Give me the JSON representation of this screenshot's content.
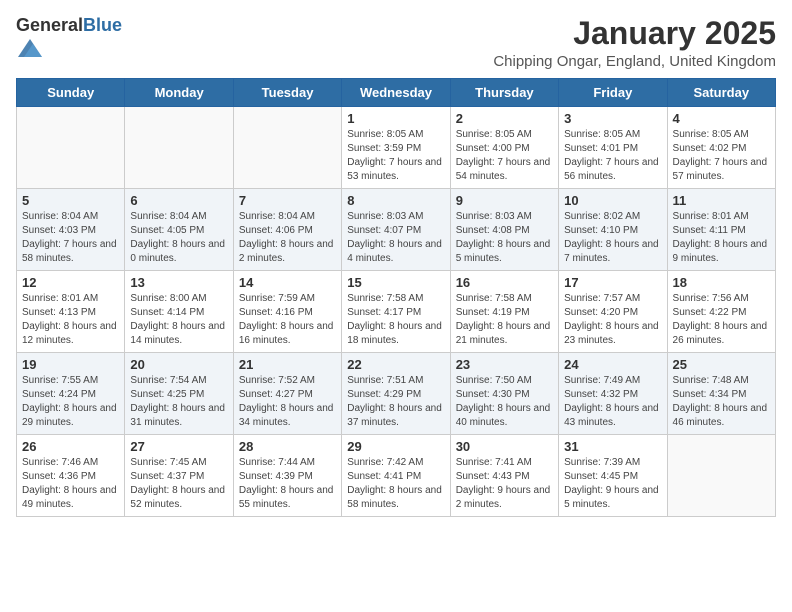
{
  "header": {
    "logo_general": "General",
    "logo_blue": "Blue",
    "month_title": "January 2025",
    "location": "Chipping Ongar, England, United Kingdom"
  },
  "weekdays": [
    "Sunday",
    "Monday",
    "Tuesday",
    "Wednesday",
    "Thursday",
    "Friday",
    "Saturday"
  ],
  "weeks": [
    [
      {
        "day": "",
        "info": ""
      },
      {
        "day": "",
        "info": ""
      },
      {
        "day": "",
        "info": ""
      },
      {
        "day": "1",
        "info": "Sunrise: 8:05 AM\nSunset: 3:59 PM\nDaylight: 7 hours and 53 minutes."
      },
      {
        "day": "2",
        "info": "Sunrise: 8:05 AM\nSunset: 4:00 PM\nDaylight: 7 hours and 54 minutes."
      },
      {
        "day": "3",
        "info": "Sunrise: 8:05 AM\nSunset: 4:01 PM\nDaylight: 7 hours and 56 minutes."
      },
      {
        "day": "4",
        "info": "Sunrise: 8:05 AM\nSunset: 4:02 PM\nDaylight: 7 hours and 57 minutes."
      }
    ],
    [
      {
        "day": "5",
        "info": "Sunrise: 8:04 AM\nSunset: 4:03 PM\nDaylight: 7 hours and 58 minutes."
      },
      {
        "day": "6",
        "info": "Sunrise: 8:04 AM\nSunset: 4:05 PM\nDaylight: 8 hours and 0 minutes."
      },
      {
        "day": "7",
        "info": "Sunrise: 8:04 AM\nSunset: 4:06 PM\nDaylight: 8 hours and 2 minutes."
      },
      {
        "day": "8",
        "info": "Sunrise: 8:03 AM\nSunset: 4:07 PM\nDaylight: 8 hours and 4 minutes."
      },
      {
        "day": "9",
        "info": "Sunrise: 8:03 AM\nSunset: 4:08 PM\nDaylight: 8 hours and 5 minutes."
      },
      {
        "day": "10",
        "info": "Sunrise: 8:02 AM\nSunset: 4:10 PM\nDaylight: 8 hours and 7 minutes."
      },
      {
        "day": "11",
        "info": "Sunrise: 8:01 AM\nSunset: 4:11 PM\nDaylight: 8 hours and 9 minutes."
      }
    ],
    [
      {
        "day": "12",
        "info": "Sunrise: 8:01 AM\nSunset: 4:13 PM\nDaylight: 8 hours and 12 minutes."
      },
      {
        "day": "13",
        "info": "Sunrise: 8:00 AM\nSunset: 4:14 PM\nDaylight: 8 hours and 14 minutes."
      },
      {
        "day": "14",
        "info": "Sunrise: 7:59 AM\nSunset: 4:16 PM\nDaylight: 8 hours and 16 minutes."
      },
      {
        "day": "15",
        "info": "Sunrise: 7:58 AM\nSunset: 4:17 PM\nDaylight: 8 hours and 18 minutes."
      },
      {
        "day": "16",
        "info": "Sunrise: 7:58 AM\nSunset: 4:19 PM\nDaylight: 8 hours and 21 minutes."
      },
      {
        "day": "17",
        "info": "Sunrise: 7:57 AM\nSunset: 4:20 PM\nDaylight: 8 hours and 23 minutes."
      },
      {
        "day": "18",
        "info": "Sunrise: 7:56 AM\nSunset: 4:22 PM\nDaylight: 8 hours and 26 minutes."
      }
    ],
    [
      {
        "day": "19",
        "info": "Sunrise: 7:55 AM\nSunset: 4:24 PM\nDaylight: 8 hours and 29 minutes."
      },
      {
        "day": "20",
        "info": "Sunrise: 7:54 AM\nSunset: 4:25 PM\nDaylight: 8 hours and 31 minutes."
      },
      {
        "day": "21",
        "info": "Sunrise: 7:52 AM\nSunset: 4:27 PM\nDaylight: 8 hours and 34 minutes."
      },
      {
        "day": "22",
        "info": "Sunrise: 7:51 AM\nSunset: 4:29 PM\nDaylight: 8 hours and 37 minutes."
      },
      {
        "day": "23",
        "info": "Sunrise: 7:50 AM\nSunset: 4:30 PM\nDaylight: 8 hours and 40 minutes."
      },
      {
        "day": "24",
        "info": "Sunrise: 7:49 AM\nSunset: 4:32 PM\nDaylight: 8 hours and 43 minutes."
      },
      {
        "day": "25",
        "info": "Sunrise: 7:48 AM\nSunset: 4:34 PM\nDaylight: 8 hours and 46 minutes."
      }
    ],
    [
      {
        "day": "26",
        "info": "Sunrise: 7:46 AM\nSunset: 4:36 PM\nDaylight: 8 hours and 49 minutes."
      },
      {
        "day": "27",
        "info": "Sunrise: 7:45 AM\nSunset: 4:37 PM\nDaylight: 8 hours and 52 minutes."
      },
      {
        "day": "28",
        "info": "Sunrise: 7:44 AM\nSunset: 4:39 PM\nDaylight: 8 hours and 55 minutes."
      },
      {
        "day": "29",
        "info": "Sunrise: 7:42 AM\nSunset: 4:41 PM\nDaylight: 8 hours and 58 minutes."
      },
      {
        "day": "30",
        "info": "Sunrise: 7:41 AM\nSunset: 4:43 PM\nDaylight: 9 hours and 2 minutes."
      },
      {
        "day": "31",
        "info": "Sunrise: 7:39 AM\nSunset: 4:45 PM\nDaylight: 9 hours and 5 minutes."
      },
      {
        "day": "",
        "info": ""
      }
    ]
  ]
}
